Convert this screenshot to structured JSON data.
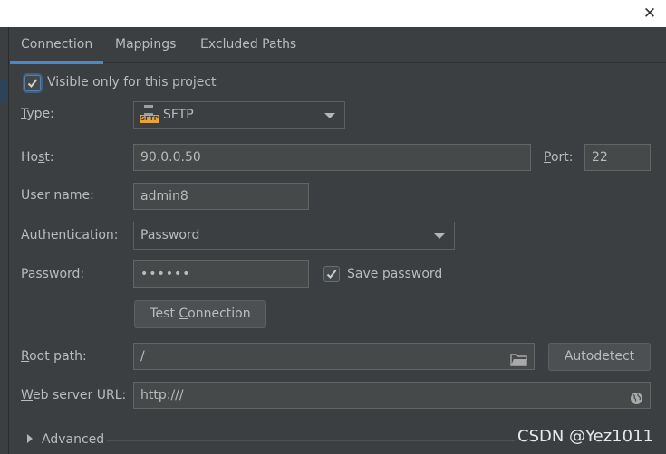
{
  "window": {
    "close_glyph": "✕"
  },
  "tabs": [
    {
      "label": "Connection",
      "active": true
    },
    {
      "label": "Mappings",
      "active": false
    },
    {
      "label": "Excluded Paths",
      "active": false
    }
  ],
  "visible_only": {
    "label": "Visible only for this project",
    "checked": true
  },
  "type": {
    "label_u": "T",
    "label_rest": "ype:",
    "value": "SFTP",
    "icon": "sftp-icon"
  },
  "host": {
    "label_pre": "Ho",
    "label_u": "s",
    "label_post": "t:",
    "value": "90.0.0.50"
  },
  "port": {
    "label_u": "P",
    "label_rest": "ort:",
    "value": "22"
  },
  "username": {
    "label": "User name:",
    "value": "admin8"
  },
  "authentication": {
    "label": "Authentication:",
    "value": "Password"
  },
  "password": {
    "label_pre": "Pass",
    "label_u": "w",
    "label_post": "ord:",
    "value": "••••••"
  },
  "save_password": {
    "label_pre": "Sa",
    "label_u": "v",
    "label_post": "e password",
    "checked": true
  },
  "test_connection": {
    "label_pre": "Test ",
    "label_u": "C",
    "label_post": "onnection"
  },
  "root_path": {
    "label_u": "R",
    "label_rest": "oot path:",
    "value": "/",
    "icon": "folder-icon"
  },
  "autodetect": {
    "label": "Autodetect"
  },
  "web_server_url": {
    "label_u": "W",
    "label_rest": "eb server URL:",
    "value": "http:///",
    "icon": "globe-icon"
  },
  "advanced": {
    "label": "Advanced"
  },
  "watermark": "CSDN @Yez1011",
  "colors": {
    "background": "#3c3f41",
    "field": "#45494a",
    "accent": "#4a88c7",
    "text": "#bbbbbb"
  }
}
